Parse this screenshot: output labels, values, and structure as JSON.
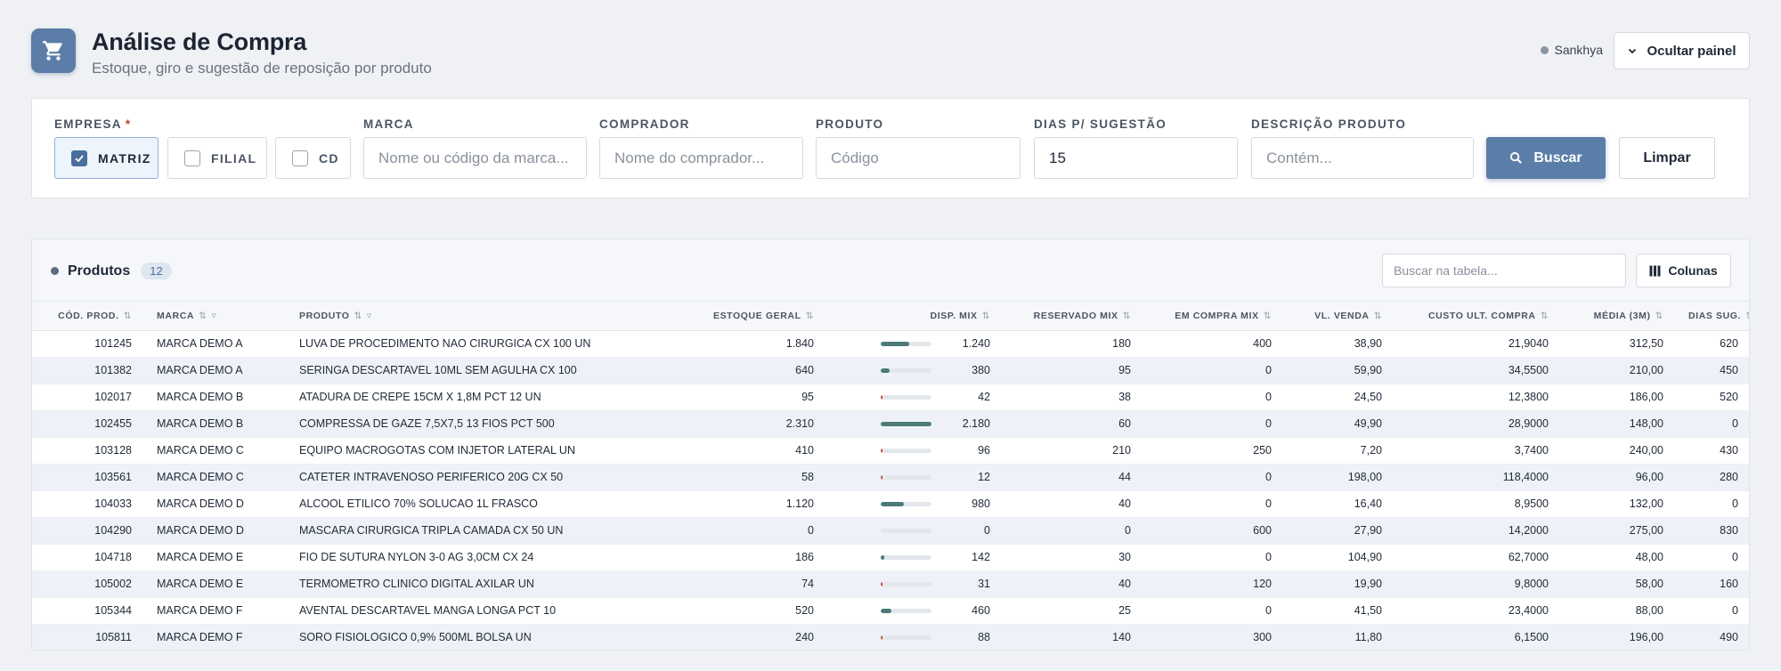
{
  "header": {
    "title": "Análise de Compra",
    "subtitle": "Estoque, giro e sugestão de reposição por produto",
    "company": "Sankhya",
    "hide_panel_label": "Ocultar painel",
    "app_icon": "cart-icon"
  },
  "filters": {
    "empresa_label": "EMPRESA",
    "required_mark": "*",
    "empresa_options": [
      {
        "label": "MATRIZ",
        "checked": true
      },
      {
        "label": "FILIAL",
        "checked": false
      },
      {
        "label": "CD",
        "checked": false
      }
    ],
    "marca_label": "MARCA",
    "marca_placeholder": "Nome ou código da marca...",
    "comprador_label": "COMPRADOR",
    "comprador_placeholder": "Nome do comprador...",
    "produto_label": "PRODUTO",
    "produto_placeholder": "Código",
    "dias_label": "DIAS P/ SUGESTÃO",
    "dias_value": "15",
    "descricao_label": "DESCRIÇÃO PRODUTO",
    "descricao_placeholder": "Contém...",
    "search_label": "Buscar",
    "clear_label": "Limpar"
  },
  "table": {
    "title": "Produtos",
    "count": "12",
    "search_placeholder": "Buscar na tabela...",
    "columns_label": "Colunas",
    "headers": [
      "CÓD. PROD.",
      "MARCA",
      "PRODUTO",
      "ESTOQUE GERAL",
      "DISP. MIX",
      "RESERVADO MIX",
      "EM COMPRA MIX",
      "VL. VENDA",
      "CUSTO ULT. COMPRA",
      "MÉDIA (3M)",
      "DIAS SUG."
    ],
    "rows": [
      {
        "cod": "101245",
        "marca": "MARCA DEMO A",
        "produto": "LUVA DE PROCEDIMENTO NAO CIRURGICA CX 100 UN",
        "estoque": "1.840",
        "disp": "1.240",
        "disp_ratio": 0.57,
        "reservado": "180",
        "em_compra": "400",
        "vl_venda": "38,90",
        "custo": "21,9040",
        "media": "312,50",
        "dias": "620"
      },
      {
        "cod": "101382",
        "marca": "MARCA DEMO A",
        "produto": "SERINGA DESCARTAVEL 10ML SEM AGULHA CX 100",
        "estoque": "640",
        "disp": "380",
        "disp_ratio": 0.17,
        "reservado": "95",
        "em_compra": "0",
        "vl_venda": "59,90",
        "custo": "34,5500",
        "media": "210,00",
        "dias": "450"
      },
      {
        "cod": "102017",
        "marca": "MARCA DEMO B",
        "produto": "ATADURA DE CREPE 15CM X 1,8M PCT 12 UN",
        "estoque": "95",
        "disp": "42",
        "disp_ratio": 0.02,
        "reservado": "38",
        "em_compra": "0",
        "vl_venda": "24,50",
        "custo": "12,3800",
        "media": "186,00",
        "dias": "520"
      },
      {
        "cod": "102455",
        "marca": "MARCA DEMO B",
        "produto": "COMPRESSA DE GAZE 7,5X7,5 13 FIOS PCT 500",
        "estoque": "2.310",
        "disp": "2.180",
        "disp_ratio": 1.0,
        "reservado": "60",
        "em_compra": "0",
        "vl_venda": "49,90",
        "custo": "28,9000",
        "media": "148,00",
        "dias": "0"
      },
      {
        "cod": "103128",
        "marca": "MARCA DEMO C",
        "produto": "EQUIPO MACROGOTAS COM INJETOR LATERAL UN",
        "estoque": "410",
        "disp": "96",
        "disp_ratio": 0.04,
        "reservado": "210",
        "em_compra": "250",
        "vl_venda": "7,20",
        "custo": "3,7400",
        "media": "240,00",
        "dias": "430"
      },
      {
        "cod": "103561",
        "marca": "MARCA DEMO C",
        "produto": "CATETER INTRAVENOSO PERIFERICO 20G CX 50",
        "estoque": "58",
        "disp": "12",
        "disp_ratio": 0.01,
        "reservado": "44",
        "em_compra": "0",
        "vl_venda": "198,00",
        "custo": "118,4000",
        "media": "96,00",
        "dias": "280"
      },
      {
        "cod": "104033",
        "marca": "MARCA DEMO D",
        "produto": "ALCOOL ETILICO 70% SOLUCAO 1L FRASCO",
        "estoque": "1.120",
        "disp": "980",
        "disp_ratio": 0.45,
        "reservado": "40",
        "em_compra": "0",
        "vl_venda": "16,40",
        "custo": "8,9500",
        "media": "132,00",
        "dias": "0"
      },
      {
        "cod": "104290",
        "marca": "MARCA DEMO D",
        "produto": "MASCARA CIRURGICA TRIPLA CAMADA CX 50 UN",
        "estoque": "0",
        "disp": "0",
        "disp_ratio": 0,
        "reservado": "0",
        "em_compra": "600",
        "vl_venda": "27,90",
        "custo": "14,2000",
        "media": "275,00",
        "dias": "830"
      },
      {
        "cod": "104718",
        "marca": "MARCA DEMO E",
        "produto": "FIO DE SUTURA NYLON 3-0 AG 3,0CM CX 24",
        "estoque": "186",
        "disp": "142",
        "disp_ratio": 0.07,
        "reservado": "30",
        "em_compra": "0",
        "vl_venda": "104,90",
        "custo": "62,7000",
        "media": "48,00",
        "dias": "0"
      },
      {
        "cod": "105002",
        "marca": "MARCA DEMO E",
        "produto": "TERMOMETRO CLINICO DIGITAL AXILAR UN",
        "estoque": "74",
        "disp": "31",
        "disp_ratio": 0.01,
        "reservado": "40",
        "em_compra": "120",
        "vl_venda": "19,90",
        "custo": "9,8000",
        "media": "58,00",
        "dias": "160"
      },
      {
        "cod": "105344",
        "marca": "MARCA DEMO F",
        "produto": "AVENTAL DESCARTAVEL MANGA LONGA PCT 10",
        "estoque": "520",
        "disp": "460",
        "disp_ratio": 0.21,
        "reservado": "25",
        "em_compra": "0",
        "vl_venda": "41,50",
        "custo": "23,4000",
        "media": "88,00",
        "dias": "0"
      },
      {
        "cod": "105811",
        "marca": "MARCA DEMO F",
        "produto": "SORO FISIOLOGICO 0,9% 500ML BOLSA UN",
        "estoque": "240",
        "disp": "88",
        "disp_ratio": 0.04,
        "reservado": "140",
        "em_compra": "300",
        "vl_venda": "11,80",
        "custo": "6,1500",
        "media": "196,00",
        "dias": "490"
      }
    ]
  },
  "colors": {
    "accent": "#5b7ea9",
    "bar_fill": "#4c7a78",
    "bar_low": "#c0503d",
    "required": "#c0392b"
  }
}
